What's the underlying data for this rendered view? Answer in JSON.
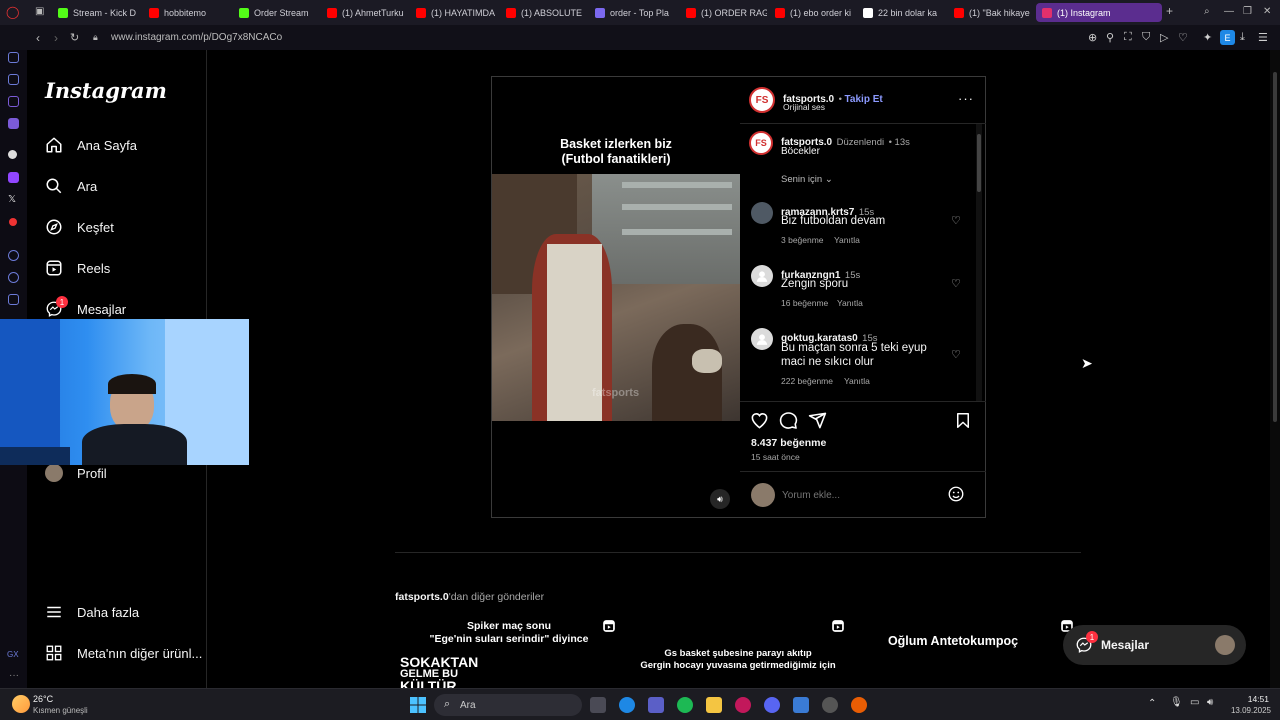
{
  "browser": {
    "tabs": [
      {
        "label": "Stream - Kick D",
        "color": "#53fc18"
      },
      {
        "label": "hobbitemo",
        "color": "#ff0000"
      },
      {
        "label": "Order Stream",
        "color": "#53fc18"
      },
      {
        "label": "(1) AhmetTurku",
        "color": "#ff0000"
      },
      {
        "label": "(1) HAYATIMDA",
        "color": "#ff0000"
      },
      {
        "label": "(1) ABSOLUTE",
        "color": "#ff0000"
      },
      {
        "label": "order - Top Pla",
        "color": "#7b68ee"
      },
      {
        "label": "(1) ORDER RAG",
        "color": "#ff0000"
      },
      {
        "label": "(1) ebo order ki",
        "color": "#ff0000"
      },
      {
        "label": "22 bin dolar ka",
        "color": "#ffffff"
      },
      {
        "label": "(1) \"Bak hikaye",
        "color": "#ff0000"
      },
      {
        "label": "(1) Instagram",
        "color": "#e1306c"
      }
    ],
    "url": "www.instagram.com/p/DOg7x8NCACo",
    "profile_letter": "E"
  },
  "sidebar": {
    "logo": "Instagram",
    "items": [
      {
        "label": "Ana Sayfa",
        "icon": "home-icon"
      },
      {
        "label": "Ara",
        "icon": "search-icon"
      },
      {
        "label": "Keşfet",
        "icon": "compass-icon"
      },
      {
        "label": "Reels",
        "icon": "reels-icon"
      },
      {
        "label": "Mesajlar",
        "icon": "messenger-icon",
        "badge": "1"
      },
      {
        "label": "Profil",
        "icon": "avatar"
      }
    ],
    "more": "Daha fazla",
    "meta": "Meta'nın diğer ürünl..."
  },
  "post": {
    "overlay_line1": "Basket izlerken biz",
    "overlay_line2": "(Futbol fanatikleri)",
    "watermark": "fatsports",
    "author": "fatsports.0",
    "follow": "Takip Et",
    "audio": "Orijinal ses",
    "caption_author": "fatsports.0",
    "caption_edited": "Düzenlendi",
    "caption_time": "13s",
    "caption_text": "Böcekler",
    "sort_label": "Senin için",
    "comments": [
      {
        "user": "ramazann.krts7",
        "time": "15s",
        "text": "Biz futboldan devam",
        "likes": "3 beğenme",
        "reply": "Yanıtla"
      },
      {
        "user": "furkanzngn1",
        "time": "15s",
        "text": "Zengin sporu",
        "likes": "16 beğenme",
        "reply": "Yanıtla"
      },
      {
        "user": "goktug.karatas0",
        "time": "15s",
        "text": "Bu maçtan sonra 5 teki eyup maci ne sıkıcı olur",
        "likes": "222 beğenme",
        "reply": "Yanıtla"
      }
    ],
    "like_count": "8.437 beğenme",
    "posted": "15 saat önce",
    "comment_placeholder": "Yorum ekle..."
  },
  "more_posts": {
    "heading_user": "fatsports.0",
    "heading_rest": "'dan diğer gönderiler",
    "thumbs": [
      {
        "line1": "Spiker maç sonu",
        "line2": "\"Ege'nin suları serindir\" diyince",
        "big1": "SOKAKTAN",
        "big2": "GELME BU",
        "big3": "KÜLTÜR"
      },
      {
        "line1": "Gs basket şubesine parayı akıtıp",
        "line2": "Gergin hocayı yuvasına getirmediğimiz için"
      },
      {
        "line1": "Oğlum Antetokumpoç"
      }
    ]
  },
  "messages_pill": {
    "label": "Mesajlar",
    "badge": "1"
  },
  "taskbar": {
    "weather_temp": "26°C",
    "weather_desc": "Kısmen güneşli",
    "search": "Ara",
    "time": "14:51",
    "date": "13.09.2025"
  }
}
